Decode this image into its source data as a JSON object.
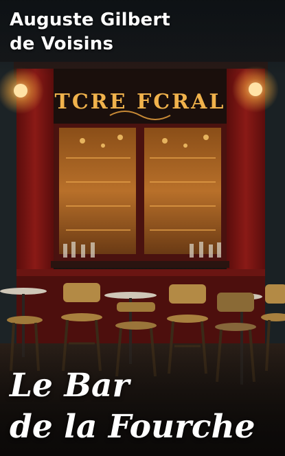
{
  "book": {
    "author_line1": "Auguste Gilbert",
    "author_line2": "de Voisins",
    "title_line1": "Le Bar",
    "title_line2": "de la Fourche"
  },
  "scene": {
    "sign_text": "TCRE FCRAL",
    "palette": {
      "wall_red": "#7a1412",
      "warm_light": "#f2b24a",
      "night": "#0f0c0a"
    }
  }
}
